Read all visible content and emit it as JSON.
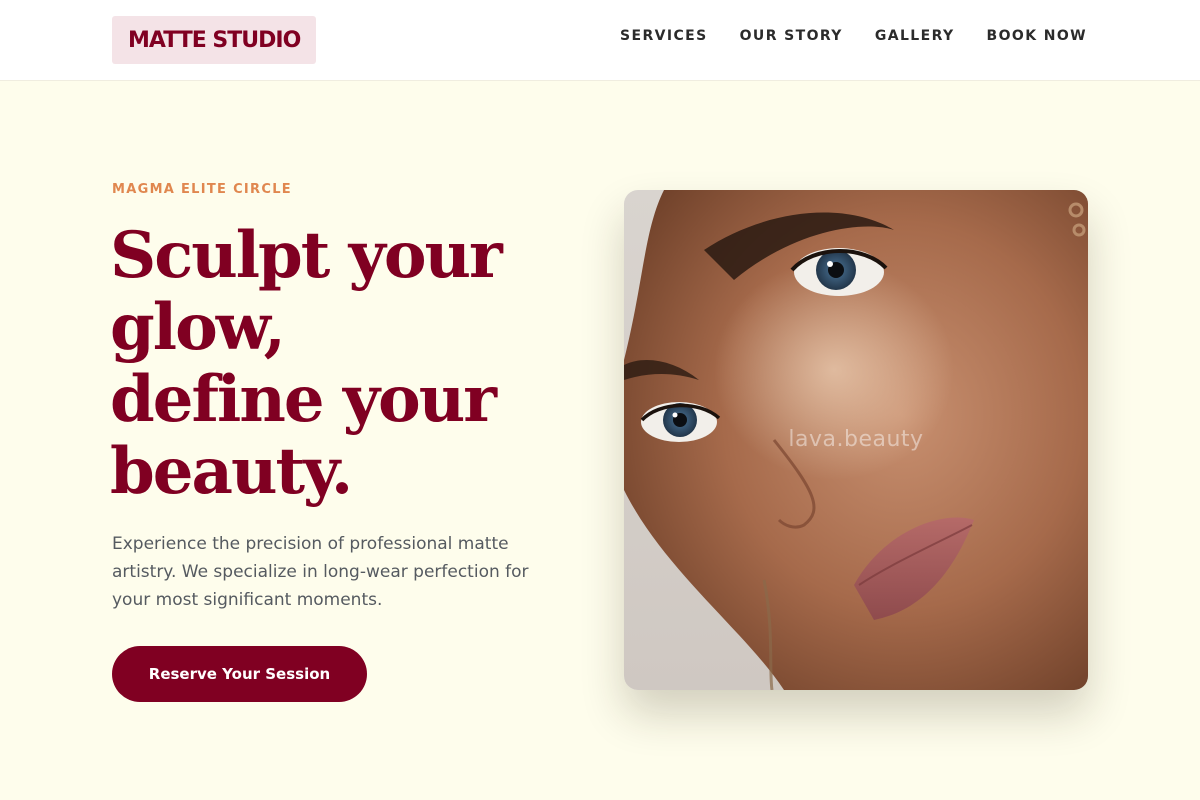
{
  "brand": {
    "name": "MATTE STUDIO",
    "primary_color": "#800022",
    "accent_color": "#e0874f",
    "background_color": "#fefdec"
  },
  "nav": {
    "items": [
      {
        "label": "SERVICES"
      },
      {
        "label": "OUR STORY"
      },
      {
        "label": "GALLERY"
      },
      {
        "label": "BOOK NOW"
      }
    ]
  },
  "hero": {
    "eyebrow": "MAGMA ELITE CIRCLE",
    "headline_lines": [
      "Sculpt your",
      "glow,",
      "define your",
      "beauty."
    ],
    "description": "Experience the precision of professional matte artistry. We specialize in long-wear perfection for your most significant moments.",
    "cta_label": "Reserve Your Session",
    "image_watermark": "lava.beauty"
  }
}
